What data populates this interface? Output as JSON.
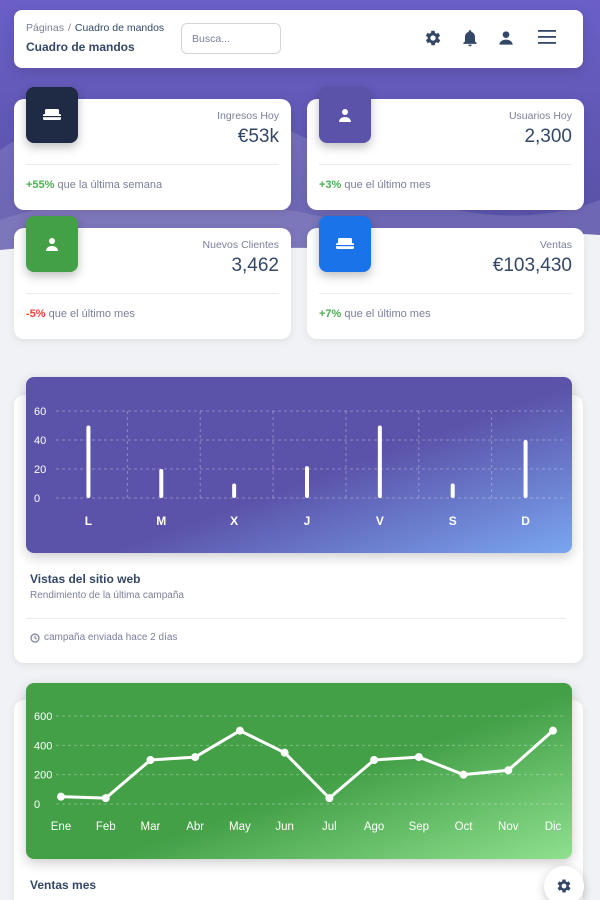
{
  "navbar": {
    "breadcrumb_root": "Páginas",
    "breadcrumb_sep": "/",
    "breadcrumb_current": "Cuadro de mandos",
    "page_title": "Cuadro de mandos",
    "search_placeholder": "Busca...",
    "icons": [
      "gear-icon",
      "bell-icon",
      "user-icon",
      "menu-icon"
    ]
  },
  "stats": [
    {
      "label": "Ingresos Hoy",
      "value": "€53k",
      "change": "+55%",
      "change_text": " que la última semana",
      "trend": "up",
      "icon": "weekend-icon",
      "color": "#1f2a44"
    },
    {
      "label": "Usuarios Hoy",
      "value": "2,300",
      "change": "+3%",
      "change_text": " que el último mes",
      "trend": "up",
      "icon": "person-icon",
      "color": "#5b53a9"
    },
    {
      "label": "Nuevos Clientes",
      "value": "3,462",
      "change": "-5%",
      "change_text": " que el último mes",
      "trend": "down",
      "icon": "person-icon",
      "color": "#43a047"
    },
    {
      "label": "Ventas",
      "value": "€103,430",
      "change": "+7%",
      "change_text": " que el último mes",
      "trend": "up",
      "icon": "weekend-icon",
      "color": "#1a73e8"
    }
  ],
  "web_views_card": {
    "title": "Vistas del sitio web",
    "subtitle": "Rendimiento de la última campaña",
    "footer": "campaña enviada hace 2 días",
    "gradient": [
      "#5b53a9",
      "#7aa6f0"
    ]
  },
  "sales_card": {
    "title": "Ventas mes",
    "gradient": [
      "#43a047",
      "#8fe08f"
    ]
  },
  "chart_data": [
    {
      "type": "bar",
      "categories": [
        "L",
        "M",
        "X",
        "J",
        "V",
        "S",
        "D"
      ],
      "values": [
        50,
        20,
        10,
        22,
        50,
        10,
        40
      ],
      "yticks": [
        0,
        20,
        40,
        60
      ],
      "ylim": [
        0,
        60
      ],
      "grid": true
    },
    {
      "type": "line",
      "categories": [
        "Ene",
        "Feb",
        "Mar",
        "Abr",
        "May",
        "Jun",
        "Jul",
        "Ago",
        "Sep",
        "Oct",
        "Nov",
        "Dic"
      ],
      "values": [
        50,
        40,
        300,
        320,
        500,
        350,
        40,
        300,
        320,
        200,
        230,
        500
      ],
      "yticks": [
        0,
        200,
        400,
        600
      ],
      "ylim": [
        0,
        600
      ],
      "grid": true
    }
  ]
}
